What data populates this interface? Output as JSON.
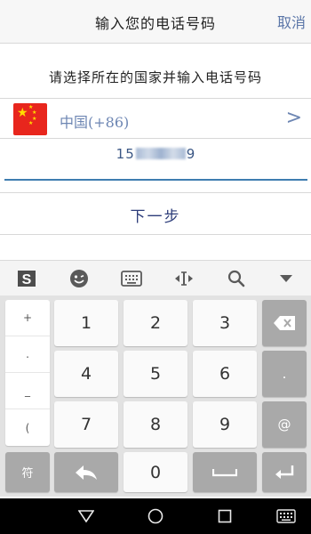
{
  "header": {
    "title": "输入您的电话号码",
    "cancel_label": "取消"
  },
  "prompt": "请选择所在的国家并输入电话号码",
  "country": {
    "name": "中国(+86)",
    "chevron": ">"
  },
  "phone": {
    "prefix": "15",
    "suffix": "9"
  },
  "next_label": "下一步",
  "toolbar": [
    "sogou-logo-icon",
    "emoji-icon",
    "keyboard-icon",
    "cursor-move-icon",
    "search-icon",
    "collapse-down-icon"
  ],
  "keyboard": {
    "side_keys": [
      "+",
      ".",
      "_",
      "("
    ],
    "rows": [
      [
        "1",
        "2",
        "3"
      ],
      [
        "4",
        "5",
        "6"
      ],
      [
        "7",
        "8",
        "9"
      ]
    ],
    "right_keys": [
      ".",
      "@"
    ],
    "symbol_label": "符",
    "zero": "0"
  },
  "colors": {
    "accent": "#3e7db0",
    "link": "#5b76a8",
    "flag_red": "#e8261d",
    "flag_star": "#ffde00"
  }
}
